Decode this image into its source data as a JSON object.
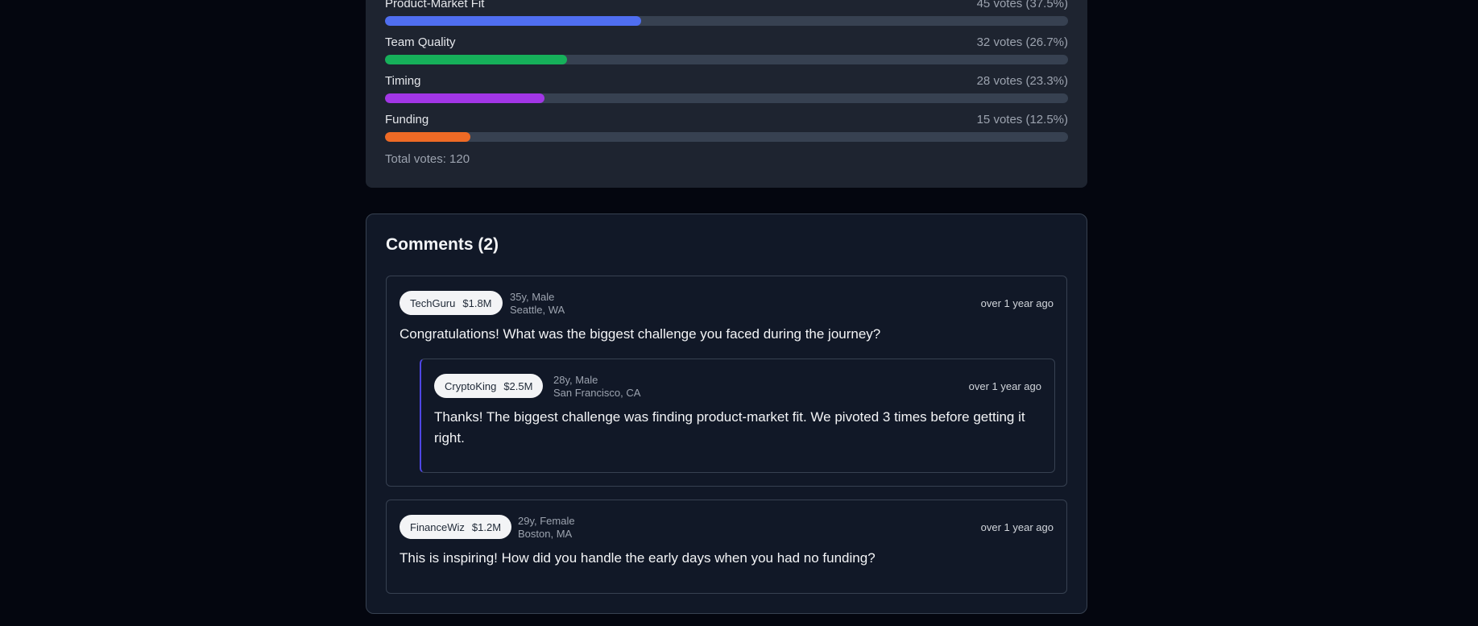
{
  "poll": {
    "options": [
      {
        "label": "Product-Market Fit",
        "votes": "45 votes (37.5%)",
        "percent": 37.5,
        "color": "#4f6ef0"
      },
      {
        "label": "Team Quality",
        "votes": "32 votes (26.7%)",
        "percent": 26.7,
        "color": "#16b05a"
      },
      {
        "label": "Timing",
        "votes": "28 votes (23.3%)",
        "percent": 23.3,
        "color": "#a236e6"
      },
      {
        "label": "Funding",
        "votes": "15 votes (12.5%)",
        "percent": 12.5,
        "color": "#ee6a25"
      }
    ],
    "total": "Total votes: 120"
  },
  "comments": {
    "title": "Comments (2)",
    "items": [
      {
        "user": "TechGuru",
        "worth": "$1.8M",
        "demo": "35y, Male",
        "location": "Seattle, WA",
        "time": "over 1 year ago",
        "text": "Congratulations! What was the biggest challenge you faced during the journey?",
        "reply": {
          "user": "CryptoKing",
          "worth": "$2.5M",
          "demo": "28y, Male",
          "location": "San Francisco, CA",
          "time": "over 1 year ago",
          "text": "Thanks! The biggest challenge was finding product-market fit. We pivoted 3 times before getting it right."
        }
      },
      {
        "user": "FinanceWiz",
        "worth": "$1.2M",
        "demo": "29y, Female",
        "location": "Boston, MA",
        "time": "over 1 year ago",
        "text": "This is inspiring! How did you handle the early days when you had no funding?"
      }
    ]
  }
}
